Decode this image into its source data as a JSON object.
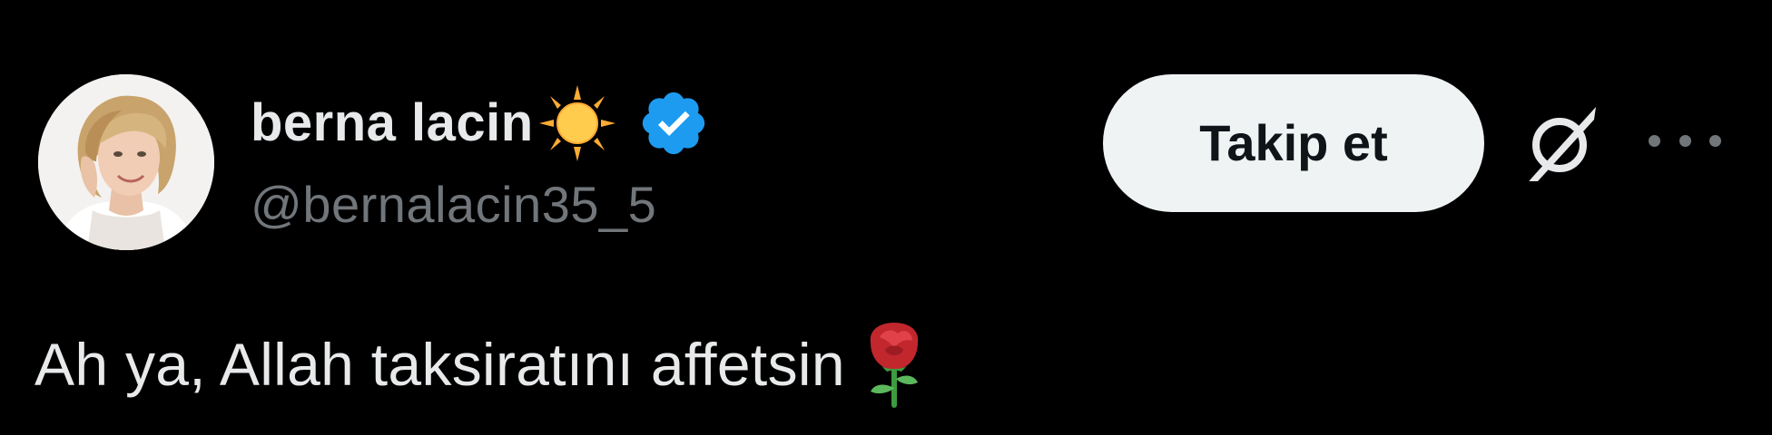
{
  "author": {
    "display_name": "berna lacin",
    "name_emoji": "sun-with-rays-emoji",
    "verified": true,
    "verified_icon": "verified-badge-icon",
    "handle": "@bernalacin35_5",
    "avatar": "profile-photo"
  },
  "actions": {
    "follow_label": "Takip et",
    "grok_icon": "grok-icon",
    "more_icon": "more-horizontal-icon"
  },
  "tweet": {
    "text": "Ah ya, Allah taksiratını affetsin",
    "trailing_emoji": "rose-emoji"
  },
  "colors": {
    "background": "#000000",
    "primary_text": "#e7e9ea",
    "secondary_text": "#71767b",
    "verified_blue": "#1d9bf0",
    "follow_button_bg": "#eff3f4",
    "follow_button_text": "#0f1419"
  }
}
